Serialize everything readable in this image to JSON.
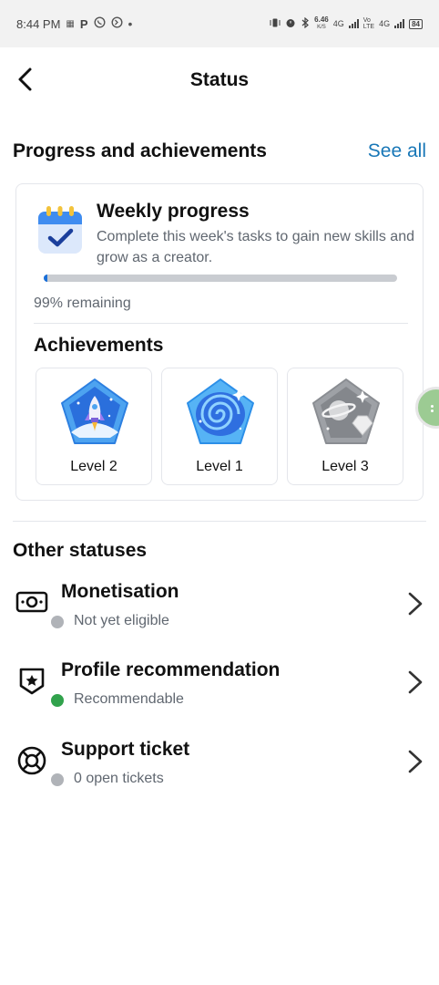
{
  "status_bar": {
    "time": "8:44 PM",
    "left_icons": [
      "sim-icon",
      "p-icon",
      "whatsapp-icon",
      "whatsapp-business-icon",
      "dot-icon"
    ],
    "p_label": "P",
    "net_speed": "6.46",
    "net_unit": "K/S",
    "sim1": "4G",
    "sim2_top": "Vo",
    "sim2_bottom": "LTE",
    "sim2": "4G",
    "battery": "84"
  },
  "header": {
    "title": "Status"
  },
  "progress": {
    "section_title": "Progress and achievements",
    "see_all": "See all",
    "weekly_title": "Weekly progress",
    "weekly_desc": "Complete this week's tasks to gain new skills and grow as a creator.",
    "progress_fraction": 0.01,
    "remaining": "99% remaining",
    "achievements_title": "Achievements",
    "badges": [
      {
        "label": "Level 2",
        "icon": "rocket-badge-icon"
      },
      {
        "label": "Level 1",
        "icon": "galaxy-badge-icon"
      },
      {
        "label": "Level 3",
        "icon": "planet-badge-icon"
      }
    ]
  },
  "other": {
    "title": "Other statuses",
    "items": [
      {
        "title": "Monetisation",
        "status": "Not yet eligible",
        "status_color": "#b0b3b8",
        "icon": "money-icon"
      },
      {
        "title": "Profile recommendation",
        "status": "Recommendable",
        "status_color": "#31a24c",
        "icon": "shield-star-icon"
      },
      {
        "title": "Support ticket",
        "status": "0 open tickets",
        "status_color": "#b0b3b8",
        "icon": "lifebuoy-icon"
      }
    ]
  },
  "colors": {
    "accent": "#1877b7",
    "progress_fill": "#1a6fd8",
    "track": "#c9ccd1"
  }
}
